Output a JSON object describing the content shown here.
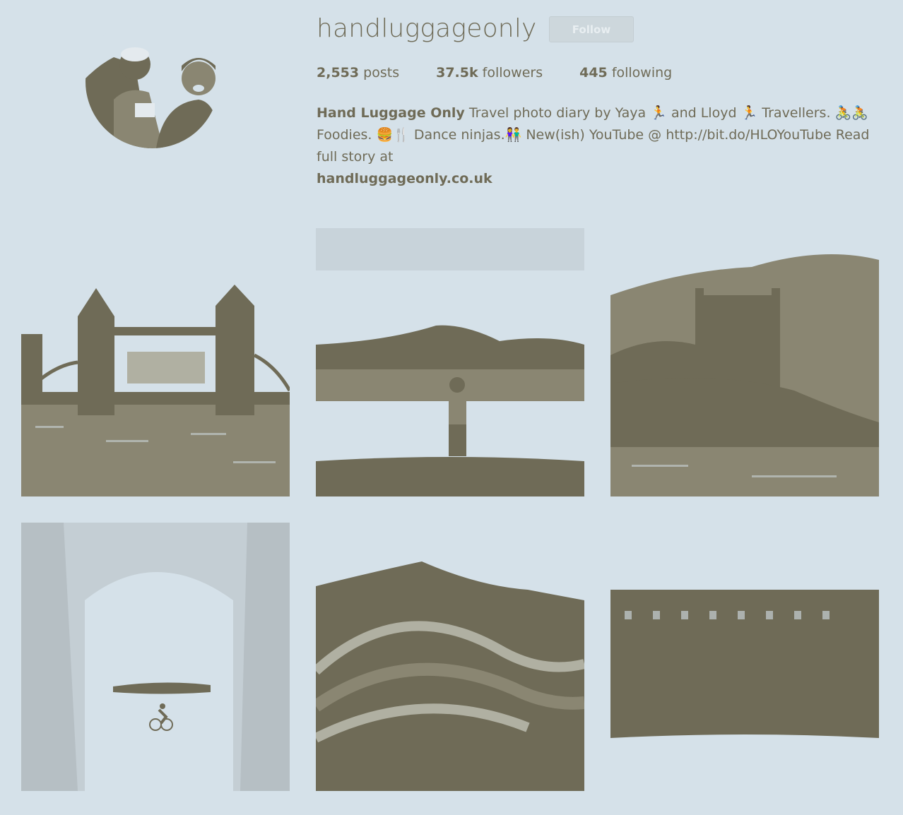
{
  "profile": {
    "username": "handluggageonly",
    "follow_label": "Follow",
    "stats": {
      "posts_count": "2,553",
      "posts_label": "posts",
      "followers_count": "37.5k",
      "followers_label": "followers",
      "following_count": "445",
      "following_label": "following"
    },
    "bio": {
      "name": "Hand Luggage Only",
      "text_1": "Travel photo diary by Yaya",
      "emoji_1": "🏃",
      "text_2": "and Lloyd",
      "emoji_2": "🏃",
      "text_3": "Travellers.",
      "emoji_3": "🚴🚴",
      "text_4": "Foodies.",
      "emoji_4": "🍔🍴",
      "text_5": "Dance ninjas.",
      "emoji_5": "👫",
      "text_6": "New(ish) YouTube @ http://bit.do/HLOYouTube Read full story at",
      "website": "handluggageonly.co.uk"
    }
  },
  "colors": {
    "background": "#d5e1e9",
    "foreground": "#6f6b57"
  },
  "posts": [
    {
      "subject": "tower-bridge-london"
    },
    {
      "subject": "person-at-lake-mountains"
    },
    {
      "subject": "castle-on-lake"
    },
    {
      "subject": "cyclist-in-ice-cave"
    },
    {
      "subject": "rainbow-mountain"
    },
    {
      "subject": "row-of-houses-by-water"
    }
  ]
}
